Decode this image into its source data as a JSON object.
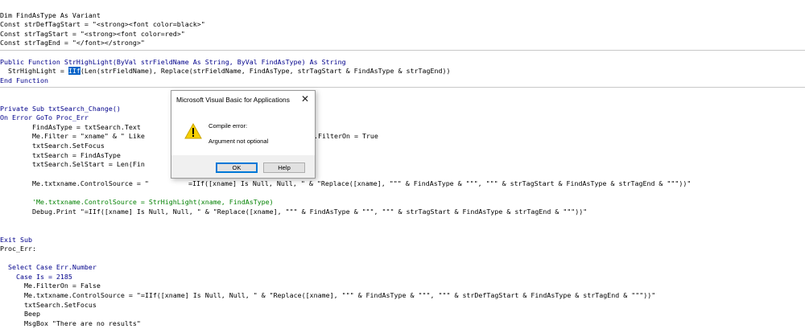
{
  "code": {
    "l1": "Dim FindAsType As Variant",
    "l2": "Const strDefTagStart = \"<strong><font color=black>\"",
    "l3": "Const strTagStart = \"<strong><font color=red>\"",
    "l4": "Const strTagEnd = \"</font></strong>\"",
    "l5a": "Public Function StrHighLight(ByVal strFieldName As String, ByVal FindAsType) As String",
    "l6a": "  StrHighLight = ",
    "l6sel": "IIf",
    "l6b": "(Len(strFieldName), Replace(strFieldName, FindAsType, strTagStart & FindAsType & strTagEnd))",
    "l7": "End Function",
    "l8": "Private Sub txtSearch_Change()",
    "l9": "On Error GoTo Proc_Err",
    "l10": "        FindAsType = txtSearch.Text",
    "l11a": "        Me.Filter = \"xname\" & \" Like",
    "l11b": ".FilterOn = True",
    "l12": "        txtSearch.SetFocus",
    "l13": "        txtSearch = FindAsType",
    "l14": "        txtSearch.SelStart = Len(Fin",
    "l15a": "        Me.txtxname.ControlSource = \"",
    "l15b": "=IIf([xname] Is Null, Null, \" & \"Replace([xname], \"\"\" & FindAsType & \"\"\", \"\"\" & strTagStart & FindAsType & strTagEnd & \"\"\"))\"",
    "l16": "        'Me.txtxname.ControlSource = StrHighLight(xname, FindAsType)",
    "l17": "        Debug.Print \"=IIf([xname] Is Null, Null, \" & \"Replace([xname], \"\"\" & FindAsType & \"\"\", \"\"\" & strTagStart & FindAsType & strTagEnd & \"\"\"))\"",
    "l18": "Exit Sub",
    "l19": "Proc_Err:",
    "l20": "  Select Case Err.Number",
    "l21": "    Case Is = 2185",
    "l22": "      Me.FilterOn = False",
    "l23": "      Me.txtxname.ControlSource = \"=IIf([xname] Is Null, Null, \" & \"Replace([xname], \"\"\" & FindAsType & \"\"\", \"\"\" & strDefTagStart & FindAsType & strTagEnd & \"\"\"))\"",
    "l24": "      txtSearch.SetFocus",
    "l25": "      Beep",
    "l26": "      MsgBox \"There are no results\""
  },
  "dialog": {
    "title": "Microsoft Visual Basic for Applications",
    "close_glyph": "✕",
    "message_line1": "Compile error:",
    "message_line2": "Argument not optional",
    "ok_label": "OK",
    "help_label": "Help",
    "icon": "warning-icon"
  },
  "colors": {
    "keyword": "#00008b",
    "comment": "#008000",
    "selection": "#0a64c8"
  }
}
